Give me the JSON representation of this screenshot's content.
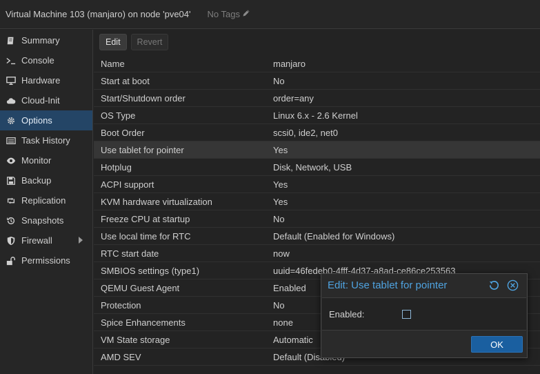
{
  "header": {
    "title": "Virtual Machine 103 (manjaro) on node 'pve04'",
    "tags_label": "No Tags"
  },
  "sidebar": {
    "items": [
      {
        "label": "Summary",
        "icon": "book-icon"
      },
      {
        "label": "Console",
        "icon": "terminal-icon"
      },
      {
        "label": "Hardware",
        "icon": "monitor-icon"
      },
      {
        "label": "Cloud-Init",
        "icon": "cloud-icon"
      },
      {
        "label": "Options",
        "icon": "gear-icon"
      },
      {
        "label": "Task History",
        "icon": "list-icon"
      },
      {
        "label": "Monitor",
        "icon": "eye-icon"
      },
      {
        "label": "Backup",
        "icon": "floppy-icon"
      },
      {
        "label": "Replication",
        "icon": "retweet-icon"
      },
      {
        "label": "Snapshots",
        "icon": "history-icon"
      },
      {
        "label": "Firewall",
        "icon": "shield-icon"
      },
      {
        "label": "Permissions",
        "icon": "unlock-icon"
      }
    ]
  },
  "toolbar": {
    "edit_label": "Edit",
    "revert_label": "Revert"
  },
  "options": {
    "rows": [
      {
        "key": "Name",
        "value": "manjaro"
      },
      {
        "key": "Start at boot",
        "value": "No"
      },
      {
        "key": "Start/Shutdown order",
        "value": "order=any"
      },
      {
        "key": "OS Type",
        "value": "Linux 6.x - 2.6 Kernel"
      },
      {
        "key": "Boot Order",
        "value": "scsi0, ide2, net0"
      },
      {
        "key": "Use tablet for pointer",
        "value": "Yes"
      },
      {
        "key": "Hotplug",
        "value": "Disk, Network, USB"
      },
      {
        "key": "ACPI support",
        "value": "Yes"
      },
      {
        "key": "KVM hardware virtualization",
        "value": "Yes"
      },
      {
        "key": "Freeze CPU at startup",
        "value": "No"
      },
      {
        "key": "Use local time for RTC",
        "value": "Default (Enabled for Windows)"
      },
      {
        "key": "RTC start date",
        "value": "now"
      },
      {
        "key": "SMBIOS settings (type1)",
        "value": "uuid=46fedeb0-4fff-4d37-a8ad-ce86ce253563"
      },
      {
        "key": "QEMU Guest Agent",
        "value": "Enabled"
      },
      {
        "key": "Protection",
        "value": "No"
      },
      {
        "key": "Spice Enhancements",
        "value": "none"
      },
      {
        "key": "VM State storage",
        "value": "Automatic"
      },
      {
        "key": "AMD SEV",
        "value": "Default (Disabled)"
      }
    ]
  },
  "dialog": {
    "title": "Edit: Use tablet for pointer",
    "field_label": "Enabled:",
    "ok_label": "OK"
  },
  "colors": {
    "accent": "#4fa3e0",
    "selected_nav": "#244566",
    "ok_button": "#1a5fa0"
  }
}
